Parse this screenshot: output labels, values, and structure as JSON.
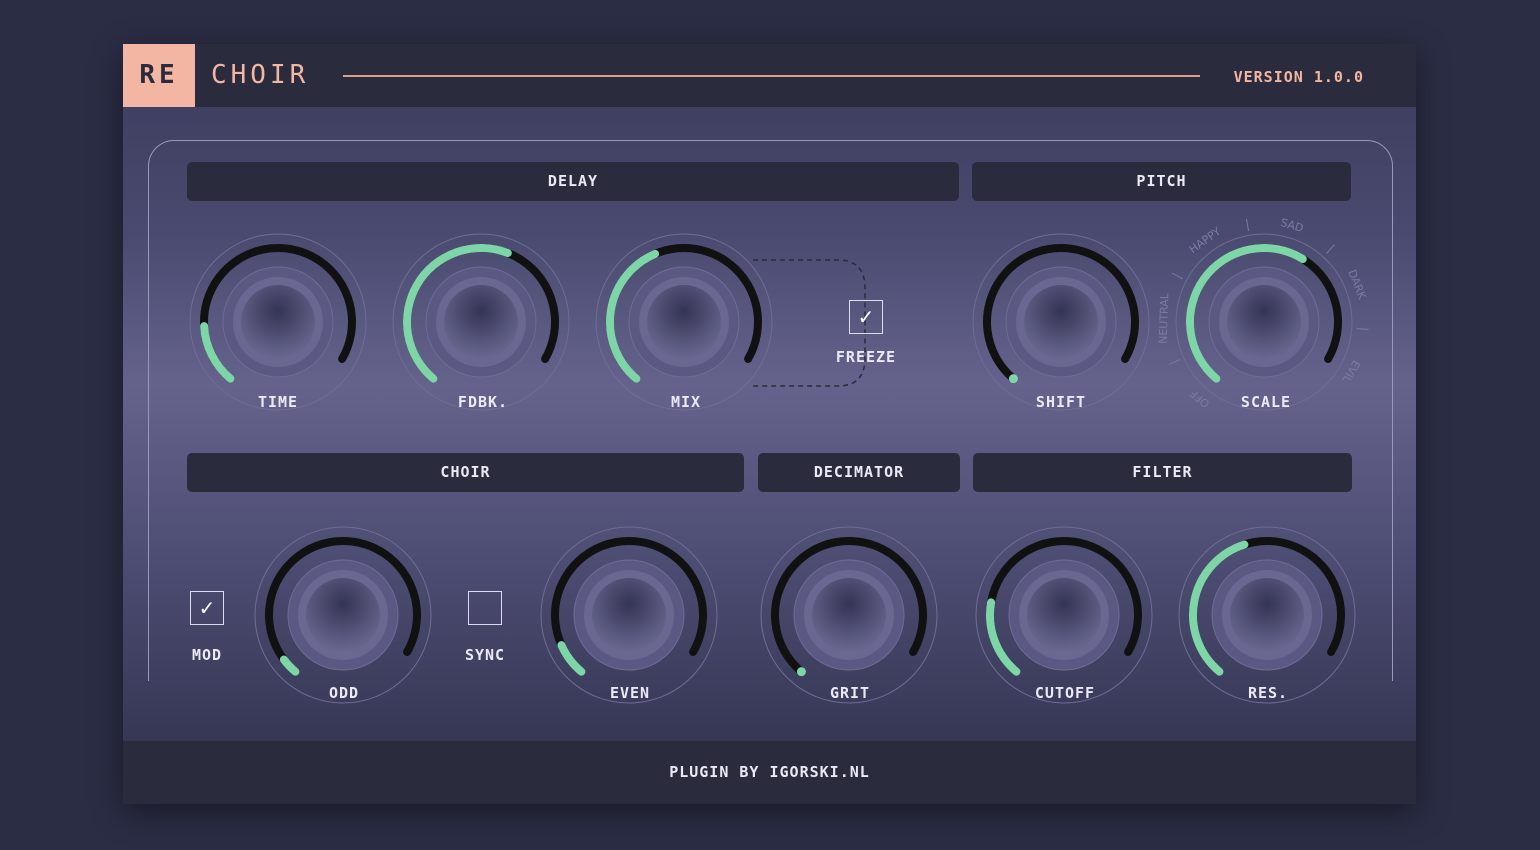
{
  "header": {
    "logo": "RE",
    "title": "CHOIR",
    "version": "VERSION 1.0.0"
  },
  "sections": {
    "delay": "DELAY",
    "pitch": "PITCH",
    "choir": "CHOIR",
    "decimator": "DECIMATOR",
    "filter": "FILTER"
  },
  "knobs": {
    "time": {
      "label": "TIME",
      "value": 0.18
    },
    "fdbk": {
      "label": "FDBK.",
      "value": 0.62
    },
    "mix": {
      "label": "MIX",
      "value": 0.45
    },
    "shift": {
      "label": "SHIFT",
      "value": 0.0
    },
    "scale": {
      "label": "SCALE",
      "value": 0.66
    },
    "odd": {
      "label": "ODD",
      "value": 0.05
    },
    "even": {
      "label": "EVEN",
      "value": 0.1
    },
    "grit": {
      "label": "GRIT",
      "value": 0.0
    },
    "cutoff": {
      "label": "CUTOFF",
      "value": 0.23
    },
    "res": {
      "label": "RES.",
      "value": 0.47
    }
  },
  "checkboxes": {
    "freeze": {
      "label": "FREEZE",
      "checked": true,
      "mark": "✓"
    },
    "mod": {
      "label": "MOD",
      "checked": true,
      "mark": "✓"
    },
    "sync": {
      "label": "SYNC",
      "checked": false,
      "mark": ""
    }
  },
  "scale_options": [
    "OFF",
    "NEUTRAL",
    "HAPPY",
    "SAD",
    "DARK",
    "EVIL"
  ],
  "footer": {
    "credit": "PLUGIN BY IGORSKI.NL"
  },
  "colors": {
    "accent_green": "#7ed6a8",
    "accent_peach": "#f3b6a2",
    "track": "#111111",
    "panel_dark": "#2a2b3d"
  }
}
